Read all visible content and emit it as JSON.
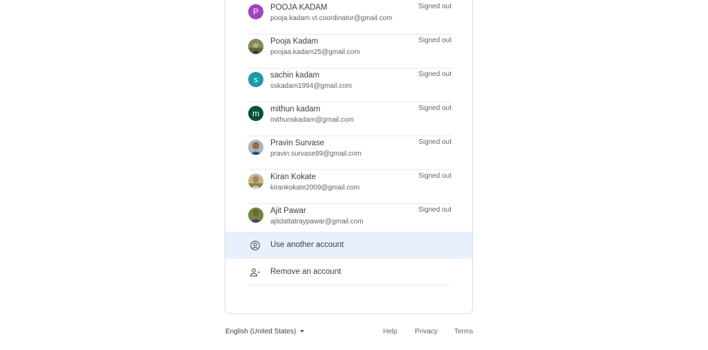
{
  "accounts": [
    {
      "name": "POOJA KADAM",
      "email": "pooja.kadam.vt.coordinator@gmail.com",
      "status": "Signed out",
      "avatar": {
        "type": "letter",
        "letter": "P",
        "color": "#a142c4"
      }
    },
    {
      "name": "Pooja Kadam",
      "email": "poojaa.kadam25@gmail.com",
      "status": "Signed out",
      "avatar": {
        "type": "photo",
        "icon": "user-photo-icon"
      }
    },
    {
      "name": "sachin kadam",
      "email": "sskadam1994@gmail.com",
      "status": "Signed out",
      "avatar": {
        "type": "letter",
        "letter": "s",
        "color": "#1a9ba8"
      }
    },
    {
      "name": "mithun kadam",
      "email": "mithunskadam@gmail.com",
      "status": "Signed out",
      "avatar": {
        "type": "letter",
        "letter": "m",
        "color": "#0b5041"
      }
    },
    {
      "name": "Pravin Survase",
      "email": "pravin.survase89@gmail.com",
      "status": "Signed out",
      "avatar": {
        "type": "photo",
        "icon": "user-photo-icon"
      }
    },
    {
      "name": "Kiran Kokate",
      "email": "kirankokate2009@gmail.com",
      "status": "Signed out",
      "avatar": {
        "type": "photo",
        "icon": "user-photo-icon"
      }
    },
    {
      "name": "Ajit Pawar",
      "email": "ajitdattatraypawar@gmail.com",
      "status": "Signed out",
      "avatar": {
        "type": "photo",
        "icon": "user-photo-icon"
      }
    }
  ],
  "actions": {
    "use_another": {
      "label": "Use another account",
      "icon": "account-circle-icon"
    },
    "remove": {
      "label": "Remove an account",
      "icon": "person-remove-icon"
    }
  },
  "footer": {
    "language": "English (United States)",
    "help": "Help",
    "privacy": "Privacy",
    "terms": "Terms"
  },
  "colors": {
    "highlight": "#e8f0fe",
    "divider": "#e8eaed"
  }
}
